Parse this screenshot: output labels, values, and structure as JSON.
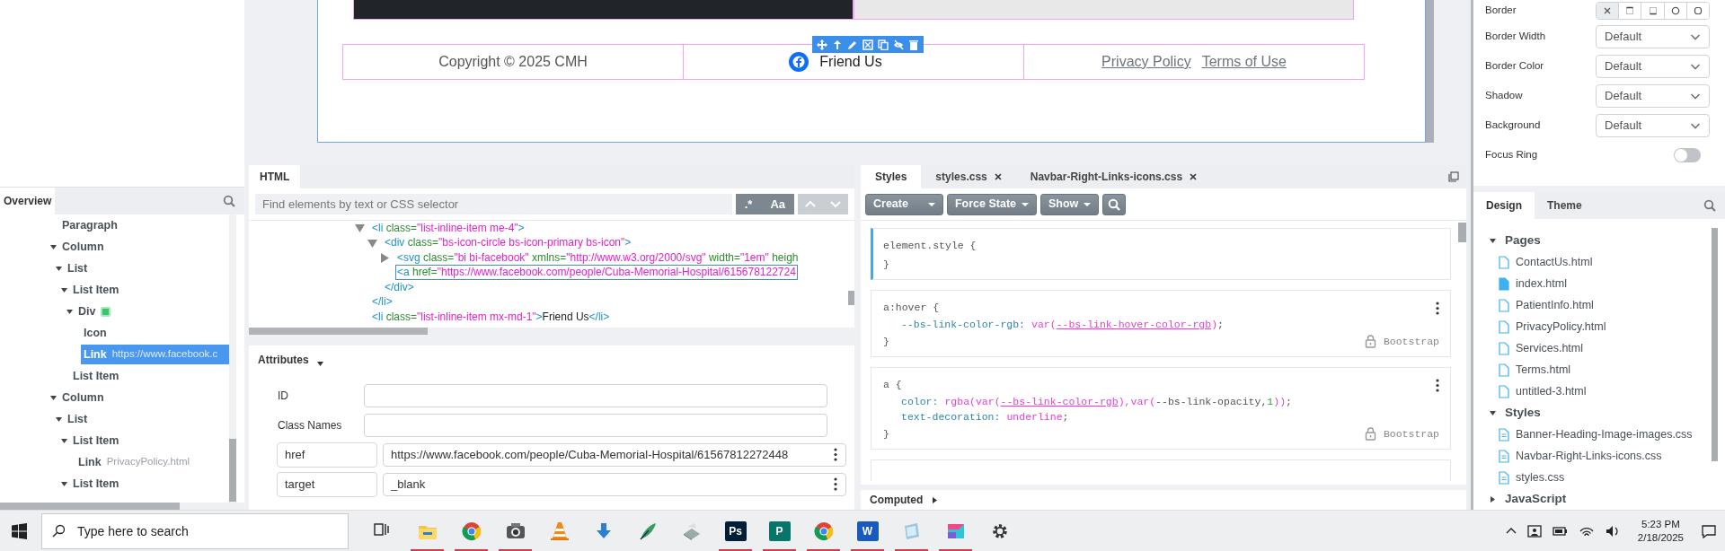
{
  "canvas": {
    "footer": [
      {
        "kind": "text",
        "text": "Copyright © 2025 CMH"
      },
      {
        "kind": "social",
        "text": "Friend Us"
      },
      {
        "kind": "links",
        "links": [
          "Privacy Policy",
          "Terms of Use"
        ]
      }
    ]
  },
  "overview": {
    "tab": "Overview",
    "tree": [
      {
        "label": "Paragraph",
        "selected": false
      },
      {
        "label": "Column",
        "expanded": true,
        "selected": false,
        "children": [
          {
            "label": "List",
            "expanded": true,
            "selected": false,
            "children": [
              {
                "label": "List Item",
                "expanded": true,
                "selected": false,
                "children": [
                  {
                    "label": "Div",
                    "expanded": true,
                    "component": true,
                    "selected": false,
                    "children": [
                      {
                        "label": "Icon",
                        "selected": false
                      },
                      {
                        "label": "Link",
                        "detail": "https://www.facebook.c",
                        "selected": true
                      }
                    ]
                  }
                ]
              },
              {
                "label": "List Item",
                "selected": false
              }
            ]
          }
        ]
      },
      {
        "label": "Column",
        "expanded": true,
        "selected": false,
        "children": [
          {
            "label": "List",
            "expanded": true,
            "selected": false,
            "children": [
              {
                "label": "List Item",
                "expanded": true,
                "selected": false,
                "children": [
                  {
                    "label": "Link",
                    "detail": "PrivacyPolicy.html",
                    "selected": false
                  }
                ]
              },
              {
                "label": "List Item",
                "expanded": true,
                "selected": false
              }
            ]
          }
        ]
      }
    ]
  },
  "html_panel": {
    "tab": "HTML",
    "search": {
      "placeholder": "Find elements by text or CSS selector"
    },
    "buttons": [
      ".*",
      "Aa"
    ],
    "code": [
      {
        "expanded": true,
        "selected": false,
        "open": [
          {
            "kind": "tag",
            "text": "<li"
          },
          {
            "kind": "attr",
            "text": " class="
          },
          {
            "kind": "val",
            "text": "\"list-inline-item me-4\""
          },
          {
            "kind": "tag",
            "text": ">"
          }
        ],
        "children": [
          {
            "expanded": true,
            "selected": false,
            "open": [
              {
                "kind": "tag",
                "text": "<div"
              },
              {
                "kind": "attr",
                "text": " class="
              },
              {
                "kind": "val",
                "text": "\"bs-icon-circle bs-icon-primary bs-icon\""
              },
              {
                "kind": "tag",
                "text": ">"
              }
            ],
            "children": [
              {
                "expanded": false,
                "selected": false,
                "open": [
                  {
                    "kind": "tag",
                    "text": "<svg"
                  },
                  {
                    "kind": "attr",
                    "text": " class="
                  },
                  {
                    "kind": "val",
                    "text": "\"bi bi-facebook\""
                  },
                  {
                    "kind": "attr",
                    "text": " xmlns="
                  },
                  {
                    "kind": "val",
                    "text": "\"http://www.w3.org/2000/svg\""
                  },
                  {
                    "kind": "attr",
                    "text": " width="
                  },
                  {
                    "kind": "val",
                    "text": "\"1em\""
                  },
                  {
                    "kind": "attr",
                    "text": " heigh"
                  }
                ]
              },
              {
                "selected": true,
                "open": [
                  {
                    "kind": "tag",
                    "text": "<a"
                  },
                  {
                    "kind": "attr",
                    "text": " href="
                  },
                  {
                    "kind": "val",
                    "text": "\"https://www.facebook.com/people/Cuba-Memorial-Hospital/615678122724"
                  }
                ]
              }
            ],
            "close": [
              {
                "kind": "tag",
                "text": "</div>"
              }
            ]
          }
        ],
        "close": [
          {
            "kind": "tag",
            "text": "</li>"
          }
        ]
      },
      {
        "selected": false,
        "open": [
          {
            "kind": "tag",
            "text": "<li"
          },
          {
            "kind": "attr",
            "text": " class="
          },
          {
            "kind": "val",
            "text": "\"list-inline-item mx-md-1\""
          },
          {
            "kind": "tag",
            "text": ">"
          },
          {
            "kind": "text",
            "text": "Friend Us"
          },
          {
            "kind": "tag",
            "text": "</li>"
          }
        ]
      }
    ],
    "attributes": {
      "title": "Attributes",
      "expanded": true,
      "rows": [
        {
          "kind": "fixed",
          "name": "ID"
        },
        {
          "kind": "fixed",
          "name": "Class Names"
        },
        {
          "kind": "custom",
          "name": "href",
          "value": "https://www.facebook.com/people/Cuba-Memorial-Hospital/61567812272448"
        },
        {
          "kind": "custom",
          "name": "target",
          "value": "_blank"
        }
      ]
    }
  },
  "styles_panel": {
    "tabs": [
      {
        "label": "Styles",
        "selected": true,
        "closable": false
      },
      {
        "label": "styles.css",
        "selected": false,
        "closable": true
      },
      {
        "label": "Navbar-Right-Links-icons.css",
        "selected": false,
        "closable": true
      }
    ],
    "toolbar": [
      {
        "kind": "split",
        "label": "Create"
      },
      {
        "kind": "dropdown",
        "label": "Force State"
      },
      {
        "kind": "dropdown",
        "label": "Show"
      },
      {
        "kind": "search"
      }
    ],
    "rules": [
      {
        "selector": "element.style",
        "brace_open": "{",
        "brace_close": "}",
        "active": true
      },
      {
        "selector": "a:hover",
        "brace_open": "{",
        "brace_close": "}",
        "active": false,
        "locked": true,
        "source": "Bootstrap",
        "declarations": [
          {
            "property": "--bs-link-color-rgb:",
            "value": [
              {
                "kind": "fn",
                "text": "var("
              },
              {
                "kind": "ref",
                "text": "--bs-link-hover-color-rgb"
              },
              {
                "kind": "fn",
                "text": ")"
              },
              {
                "kind": "plain",
                "text": ";"
              }
            ]
          }
        ]
      },
      {
        "selector": "a",
        "brace_open": "{",
        "brace_close": "}",
        "active": false,
        "locked": true,
        "source": "Bootstrap",
        "declarations": [
          {
            "property": "color:",
            "value": [
              {
                "kind": "fn",
                "text": "rgba(var("
              },
              {
                "kind": "ref",
                "text": "--bs-link-color-rgb"
              },
              {
                "kind": "fn",
                "text": "),var("
              },
              {
                "kind": "plain",
                "text": "--bs-link-opacity,"
              },
              {
                "kind": "num",
                "text": "1"
              },
              {
                "kind": "fn",
                "text": "))"
              },
              {
                "kind": "plain",
                "text": ";"
              }
            ]
          },
          {
            "property": "text-decoration:",
            "value": [
              {
                "kind": "fn",
                "text": "underline"
              },
              {
                "kind": "plain",
                "text": ";"
              }
            ]
          }
        ]
      }
    ],
    "computed": {
      "label": "Computed",
      "expanded": false
    }
  },
  "properties": {
    "border": {
      "label": "Border",
      "options": [
        {
          "kind": "none",
          "selected": true
        },
        {
          "kind": "top",
          "selected": false
        },
        {
          "kind": "bottom",
          "selected": false
        },
        {
          "kind": "circle",
          "selected": false
        },
        {
          "kind": "rounded",
          "selected": false
        }
      ]
    },
    "selects": [
      {
        "label": "Border Width",
        "value": "Default"
      },
      {
        "label": "Border Color",
        "value": "Default"
      },
      {
        "label": "Shadow",
        "value": "Default"
      },
      {
        "label": "Background",
        "value": "Default"
      }
    ],
    "toggles": [
      {
        "label": "Focus Ring",
        "on": false
      }
    ]
  },
  "design_panel": {
    "tabs": [
      {
        "label": "Design",
        "selected": true
      },
      {
        "label": "Theme",
        "selected": false
      }
    ],
    "tree": [
      {
        "label": "Pages",
        "expanded": true,
        "children": [
          {
            "label": "ContactUs.html",
            "kind": "page",
            "current": false
          },
          {
            "label": "index.html",
            "kind": "page",
            "current": true
          },
          {
            "label": "PatientInfo.html",
            "kind": "page",
            "current": false
          },
          {
            "label": "PrivacyPolicy.html",
            "kind": "page",
            "current": false
          },
          {
            "label": "Services.html",
            "kind": "page",
            "current": false
          },
          {
            "label": "Terms.html",
            "kind": "page",
            "current": false
          },
          {
            "label": "untitled-3.html",
            "kind": "page",
            "current": false
          }
        ]
      },
      {
        "label": "Styles",
        "expanded": true,
        "children": [
          {
            "label": "Banner-Heading-Image-images.css",
            "kind": "style",
            "current": false
          },
          {
            "label": "Navbar-Right-Links-icons.css",
            "kind": "style",
            "current": false
          },
          {
            "label": "styles.css",
            "kind": "style",
            "current": false
          }
        ]
      },
      {
        "label": "JavaScript",
        "expanded": false
      }
    ]
  },
  "taskbar": {
    "search": {
      "placeholder": "Type here to search"
    },
    "apps": [
      {
        "kind": "taskview",
        "running": false
      },
      {
        "kind": "folder",
        "running": true
      },
      {
        "kind": "browser",
        "running": true
      },
      {
        "kind": "camera",
        "running": true
      },
      {
        "kind": "cone",
        "running": false
      },
      {
        "kind": "download",
        "running": false
      },
      {
        "kind": "pen",
        "running": false
      },
      {
        "kind": "scanner",
        "running": false
      },
      {
        "kind": "tile",
        "label": "Ps",
        "color": "#001e36",
        "running": true
      },
      {
        "kind": "tile",
        "label": "P",
        "color": "#077568",
        "running": true
      },
      {
        "kind": "browser",
        "running": true
      },
      {
        "kind": "tile",
        "label": "W",
        "color": "#185abd",
        "running": true
      },
      {
        "kind": "glass",
        "running": true
      },
      {
        "kind": "cube",
        "running": true
      },
      {
        "kind": "gear",
        "running": false
      }
    ],
    "time": "5:23 PM",
    "date": "2/18/2025"
  }
}
